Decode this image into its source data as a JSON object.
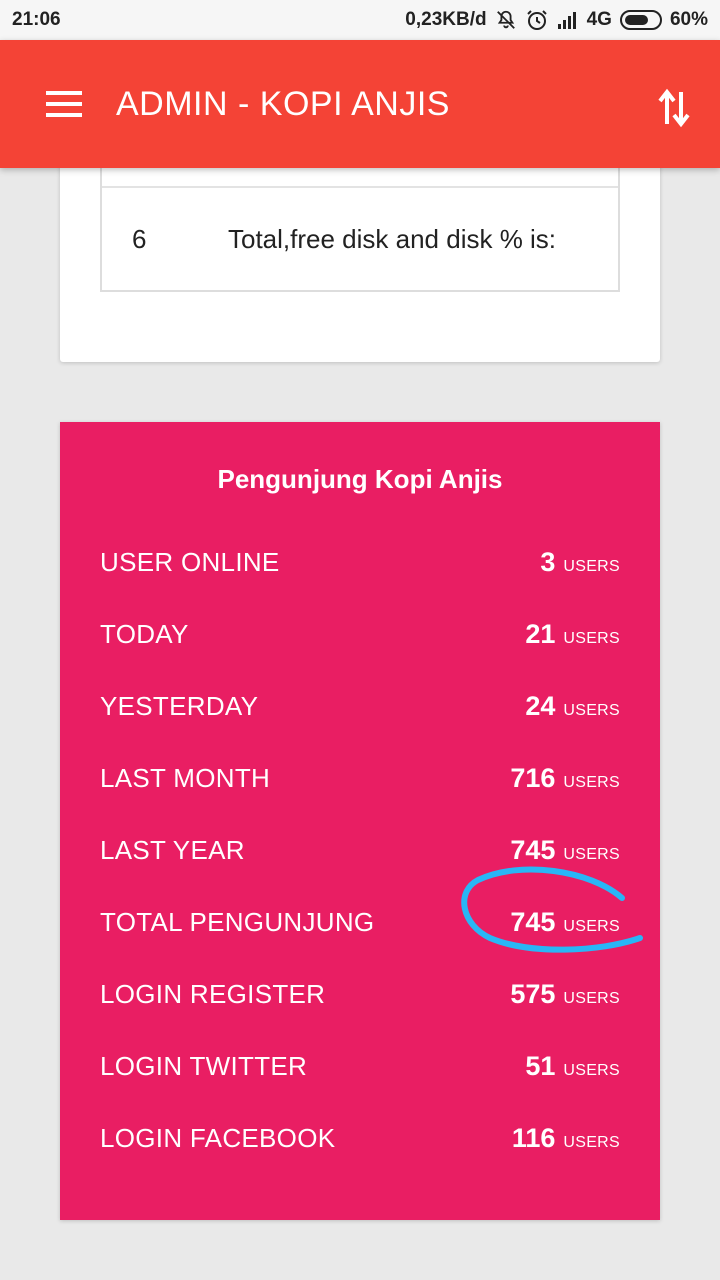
{
  "status_bar": {
    "time": "21:06",
    "speed": "0,23KB/d",
    "network": "4G",
    "battery": "60%"
  },
  "app_bar": {
    "title": "ADMIN - KOPI ANJIS",
    "menu_icon": "hamburger-menu-icon",
    "sort_icon": "swap-vertical-icon"
  },
  "info_table": {
    "rows": [
      {
        "number": "6",
        "label": "Total,free disk and disk % is:"
      }
    ]
  },
  "visitors": {
    "title": "Pengunjung Kopi Anjis",
    "unit": "USERS",
    "rows": [
      {
        "label": "USER ONLINE",
        "value": "3"
      },
      {
        "label": "TODAY",
        "value": "21"
      },
      {
        "label": "YESTERDAY",
        "value": "24"
      },
      {
        "label": "LAST MONTH",
        "value": "716"
      },
      {
        "label": "LAST YEAR",
        "value": "745"
      },
      {
        "label": "TOTAL PENGUNJUNG",
        "value": "745"
      },
      {
        "label": "LOGIN REGISTER",
        "value": "575"
      },
      {
        "label": "LOGIN TWITTER",
        "value": "51"
      },
      {
        "label": "LOGIN FACEBOOK",
        "value": "116"
      }
    ]
  },
  "colors": {
    "app_bar": "#f44336",
    "stats_card": "#e91e63",
    "annotation": "#29b6f6",
    "background": "#e9e9e9"
  }
}
